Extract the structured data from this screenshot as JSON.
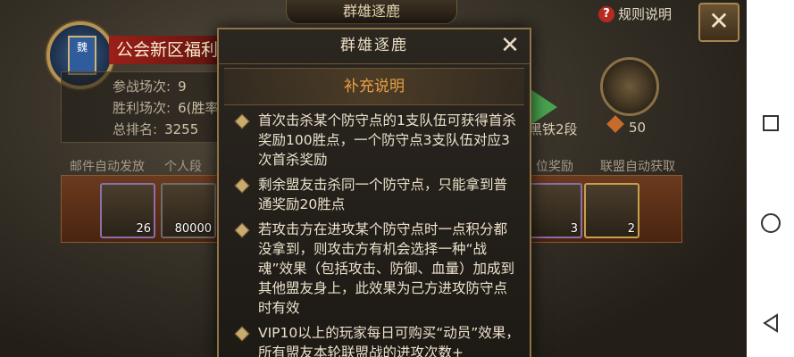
{
  "header": {
    "title": "群雄逐鹿",
    "rules_label": "规则说明"
  },
  "guild": {
    "emblem_text": "魏",
    "name": "公会新区福利",
    "stats": [
      {
        "label": "参战场次:",
        "value": "9"
      },
      {
        "label": "胜利场次:",
        "value": "6(胜率"
      },
      {
        "label": "总排名:",
        "value": "3255"
      }
    ]
  },
  "rank": {
    "name": "黑铁2段",
    "points": "50"
  },
  "sections": {
    "mail_auto": "邮件自动发放",
    "personal": "个人段",
    "tier_reward": "位奖励",
    "alliance_auto": "联盟自动获取"
  },
  "rewards": [
    {
      "count": "26"
    },
    {
      "count": "80000"
    },
    {
      "count": "3"
    },
    {
      "count": "2"
    }
  ],
  "dialog": {
    "title": "群雄逐鹿",
    "subtitle": "补充说明",
    "notes": [
      "首次击杀某个防守点的1支队伍可获得首杀奖励100胜点，一个防守点3支队伍对应3次首杀奖励",
      "剩余盟友击杀同一个防守点，只能拿到普通奖励20胜点",
      "若攻击方在进攻某个防守点时一点积分都没拿到，则攻击方有机会选择一种“战魂”效果（包括攻击、防御、血量）加成到其他盟友身上，此效果为己方进攻防守点时有效",
      "VIP10以上的玩家每日可购买“动员”效果，所有盟友本轮联盟战的进攻次数+"
    ]
  },
  "colors": {
    "accent_orange": "#e9a042",
    "dialog_border": "#8e7446",
    "guild_red": "#9b1f18",
    "rank_green": "#4aa350"
  },
  "icons": {
    "close": "close-icon",
    "help": "help-icon",
    "back": "back-triangle-icon",
    "home": "home-circle-icon",
    "recents": "recents-square-icon"
  }
}
